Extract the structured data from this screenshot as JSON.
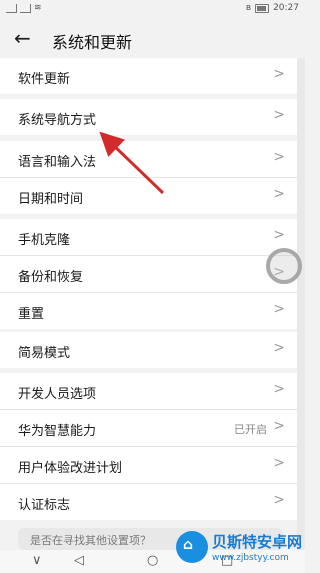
{
  "status_bar": {
    "time": "20:27"
  },
  "header": {
    "title": "系统和更新"
  },
  "groups": [
    {
      "items": [
        {
          "label": "软件更新"
        }
      ]
    },
    {
      "items": [
        {
          "label": "系统导航方式"
        }
      ]
    },
    {
      "items": [
        {
          "label": "语言和输入法"
        },
        {
          "label": "日期和时间"
        }
      ]
    },
    {
      "items": [
        {
          "label": "手机克隆"
        },
        {
          "label": "备份和恢复"
        },
        {
          "label": "重置"
        }
      ]
    },
    {
      "items": [
        {
          "label": "简易模式"
        }
      ]
    },
    {
      "items": [
        {
          "label": "开发人员选项"
        },
        {
          "label": "华为智慧能力",
          "value": "已开启"
        },
        {
          "label": "用户体验改进计划"
        },
        {
          "label": "认证标志"
        }
      ]
    }
  ],
  "hint": {
    "text": "是否在寻找其他设置项？"
  },
  "nav_bar": {
    "back": "∨",
    "home": "◁",
    "recent": "○",
    "square": "□"
  },
  "watermark": {
    "title": "贝斯特安卓网",
    "url": "www.zjbstyy.com"
  },
  "colors": {
    "arrow": "#d22b2b",
    "accent_blue": "#1a7cd1"
  }
}
